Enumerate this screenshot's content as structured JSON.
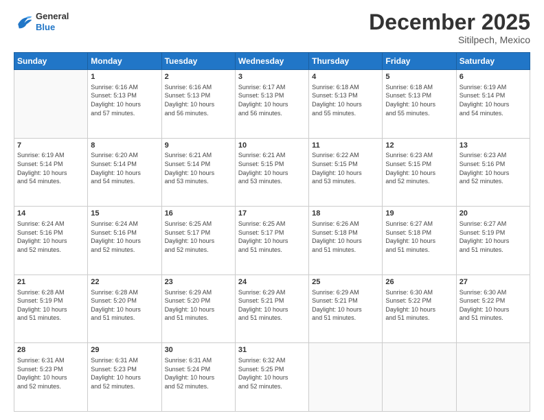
{
  "header": {
    "logo": {
      "general": "General",
      "blue": "Blue"
    },
    "title": "December 2025",
    "location": "Sitilpech, Mexico"
  },
  "weekdays": [
    "Sunday",
    "Monday",
    "Tuesday",
    "Wednesday",
    "Thursday",
    "Friday",
    "Saturday"
  ],
  "weeks": [
    [
      {
        "day": "",
        "info": ""
      },
      {
        "day": "1",
        "info": "Sunrise: 6:16 AM\nSunset: 5:13 PM\nDaylight: 10 hours\nand 57 minutes."
      },
      {
        "day": "2",
        "info": "Sunrise: 6:16 AM\nSunset: 5:13 PM\nDaylight: 10 hours\nand 56 minutes."
      },
      {
        "day": "3",
        "info": "Sunrise: 6:17 AM\nSunset: 5:13 PM\nDaylight: 10 hours\nand 56 minutes."
      },
      {
        "day": "4",
        "info": "Sunrise: 6:18 AM\nSunset: 5:13 PM\nDaylight: 10 hours\nand 55 minutes."
      },
      {
        "day": "5",
        "info": "Sunrise: 6:18 AM\nSunset: 5:13 PM\nDaylight: 10 hours\nand 55 minutes."
      },
      {
        "day": "6",
        "info": "Sunrise: 6:19 AM\nSunset: 5:14 PM\nDaylight: 10 hours\nand 54 minutes."
      }
    ],
    [
      {
        "day": "7",
        "info": "Sunrise: 6:19 AM\nSunset: 5:14 PM\nDaylight: 10 hours\nand 54 minutes."
      },
      {
        "day": "8",
        "info": "Sunrise: 6:20 AM\nSunset: 5:14 PM\nDaylight: 10 hours\nand 54 minutes."
      },
      {
        "day": "9",
        "info": "Sunrise: 6:21 AM\nSunset: 5:14 PM\nDaylight: 10 hours\nand 53 minutes."
      },
      {
        "day": "10",
        "info": "Sunrise: 6:21 AM\nSunset: 5:15 PM\nDaylight: 10 hours\nand 53 minutes."
      },
      {
        "day": "11",
        "info": "Sunrise: 6:22 AM\nSunset: 5:15 PM\nDaylight: 10 hours\nand 53 minutes."
      },
      {
        "day": "12",
        "info": "Sunrise: 6:23 AM\nSunset: 5:15 PM\nDaylight: 10 hours\nand 52 minutes."
      },
      {
        "day": "13",
        "info": "Sunrise: 6:23 AM\nSunset: 5:16 PM\nDaylight: 10 hours\nand 52 minutes."
      }
    ],
    [
      {
        "day": "14",
        "info": "Sunrise: 6:24 AM\nSunset: 5:16 PM\nDaylight: 10 hours\nand 52 minutes."
      },
      {
        "day": "15",
        "info": "Sunrise: 6:24 AM\nSunset: 5:16 PM\nDaylight: 10 hours\nand 52 minutes."
      },
      {
        "day": "16",
        "info": "Sunrise: 6:25 AM\nSunset: 5:17 PM\nDaylight: 10 hours\nand 52 minutes."
      },
      {
        "day": "17",
        "info": "Sunrise: 6:25 AM\nSunset: 5:17 PM\nDaylight: 10 hours\nand 51 minutes."
      },
      {
        "day": "18",
        "info": "Sunrise: 6:26 AM\nSunset: 5:18 PM\nDaylight: 10 hours\nand 51 minutes."
      },
      {
        "day": "19",
        "info": "Sunrise: 6:27 AM\nSunset: 5:18 PM\nDaylight: 10 hours\nand 51 minutes."
      },
      {
        "day": "20",
        "info": "Sunrise: 6:27 AM\nSunset: 5:19 PM\nDaylight: 10 hours\nand 51 minutes."
      }
    ],
    [
      {
        "day": "21",
        "info": "Sunrise: 6:28 AM\nSunset: 5:19 PM\nDaylight: 10 hours\nand 51 minutes."
      },
      {
        "day": "22",
        "info": "Sunrise: 6:28 AM\nSunset: 5:20 PM\nDaylight: 10 hours\nand 51 minutes."
      },
      {
        "day": "23",
        "info": "Sunrise: 6:29 AM\nSunset: 5:20 PM\nDaylight: 10 hours\nand 51 minutes."
      },
      {
        "day": "24",
        "info": "Sunrise: 6:29 AM\nSunset: 5:21 PM\nDaylight: 10 hours\nand 51 minutes."
      },
      {
        "day": "25",
        "info": "Sunrise: 6:29 AM\nSunset: 5:21 PM\nDaylight: 10 hours\nand 51 minutes."
      },
      {
        "day": "26",
        "info": "Sunrise: 6:30 AM\nSunset: 5:22 PM\nDaylight: 10 hours\nand 51 minutes."
      },
      {
        "day": "27",
        "info": "Sunrise: 6:30 AM\nSunset: 5:22 PM\nDaylight: 10 hours\nand 51 minutes."
      }
    ],
    [
      {
        "day": "28",
        "info": "Sunrise: 6:31 AM\nSunset: 5:23 PM\nDaylight: 10 hours\nand 52 minutes."
      },
      {
        "day": "29",
        "info": "Sunrise: 6:31 AM\nSunset: 5:23 PM\nDaylight: 10 hours\nand 52 minutes."
      },
      {
        "day": "30",
        "info": "Sunrise: 6:31 AM\nSunset: 5:24 PM\nDaylight: 10 hours\nand 52 minutes."
      },
      {
        "day": "31",
        "info": "Sunrise: 6:32 AM\nSunset: 5:25 PM\nDaylight: 10 hours\nand 52 minutes."
      },
      {
        "day": "",
        "info": ""
      },
      {
        "day": "",
        "info": ""
      },
      {
        "day": "",
        "info": ""
      }
    ]
  ]
}
